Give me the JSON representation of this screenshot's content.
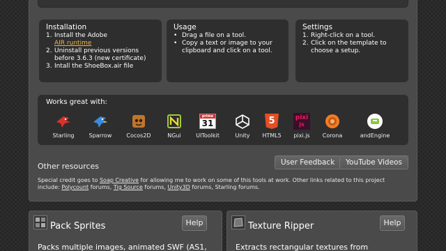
{
  "installation": {
    "title": "Installation",
    "step1_num": "1.",
    "step1_text": "Install the Adobe",
    "step1_link": "AIR runtime",
    "step2_num": "2.",
    "step2_text": "Uninstall previous versions before 3.6.3 (new certificate)",
    "step3_num": "3.",
    "step3_text": "Intall the ShoeBox.air file"
  },
  "usage": {
    "title": "Usage",
    "bullet1": "Drag a file on a tool.",
    "bullet2": "Copy a text or image to your clipboard and click on a tool."
  },
  "settings": {
    "title": "Settings",
    "step1_num": "1.",
    "step1": "Right-click on a tool.",
    "step2_num": "2.",
    "step2": "Click on the template to choose a setup."
  },
  "works": {
    "title": "Works great with:",
    "tools": [
      {
        "label": "Starling",
        "icon": "starling-bird-icon",
        "color": "#d9322b"
      },
      {
        "label": "Sparrow",
        "icon": "sparrow-bird-icon",
        "color": "#3c8bd8"
      },
      {
        "label": "Cocos2D",
        "icon": "cocos2d-icon",
        "color": "#c0752a"
      },
      {
        "label": "NGui",
        "icon": "ngui-icon",
        "color": "#9ccc3a"
      },
      {
        "label": "UIToolkit",
        "icon": "uitoolkit-calendar-icon",
        "color": "#ffffff"
      },
      {
        "label": "Unity",
        "icon": "unity-icon",
        "color": "#ffffff"
      },
      {
        "label": "HTML5",
        "icon": "html5-icon",
        "color": "#e34f26"
      },
      {
        "label": "pixi.js",
        "icon": "pixijs-icon",
        "color": "#e91e63"
      },
      {
        "label": "Corona",
        "icon": "corona-icon",
        "color": "#f07d2a"
      },
      {
        "label": "andEngine",
        "icon": "andengine-icon",
        "color": "#8cc63f"
      }
    ]
  },
  "other": {
    "title": "Other resources",
    "user_feedback": "User Feedback",
    "youtube_videos": "YouTube Videos"
  },
  "credit": {
    "p1": "Special credit goes to ",
    "soap": "Soap Creative",
    "p2": " for allowing me to work on some of this tools at work. Other links related to this project include: ",
    "polycount": "Polycount",
    "p3": " forums, ",
    "tigsource": "Tig Source",
    "p4": " forums, ",
    "unity3d": "Unity3D",
    "p5": " forums, Starling forums."
  },
  "pack_sprites": {
    "title": "Pack Sprites",
    "help": "Help",
    "desc": "Packs multiple images, animated SWF (AS1,"
  },
  "texture_ripper": {
    "title": "Texture Ripper",
    "help": "Help",
    "desc": "Extracts rectangular textures from"
  },
  "ui_text": {
    "uitoolkit_glyph": "31",
    "uitoolkit_header": "prime",
    "pixi_glyph": "pixi",
    "pixi_sub": "js",
    "html5_glyph": "5",
    "unity_glyph": "◈",
    "bird_glyph": "◢",
    "bullet": "•"
  }
}
